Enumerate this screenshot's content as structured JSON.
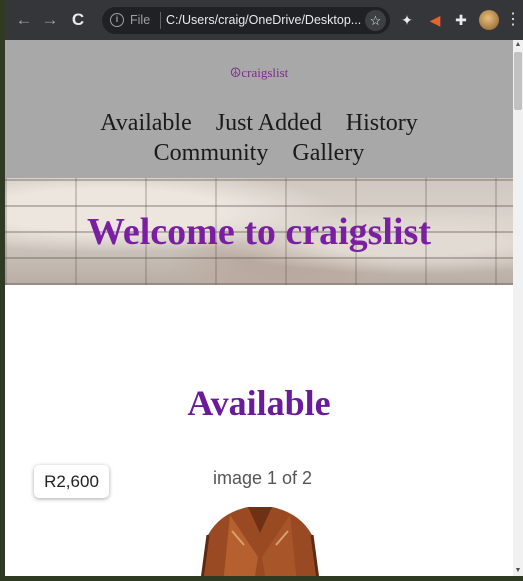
{
  "browser": {
    "url_prefix": "File",
    "url": "C:/Users/craig/OneDrive/Desktop...",
    "back_glyph": "←",
    "forward_glyph": "→",
    "reload_glyph": "C",
    "star_glyph": "☆",
    "menu_glyph": "⋮"
  },
  "site": {
    "logo": "☮craigslist",
    "nav_row1": [
      "Available",
      "Just Added",
      "History"
    ],
    "nav_row2": [
      "Community",
      "Gallery"
    ],
    "hero_title": "Welcome to craigslist"
  },
  "main": {
    "section_title": "Available",
    "price": "R2,600",
    "image_caption": "image 1 of 2"
  },
  "colors": {
    "accent_purple": "#7b1fa2",
    "header_gray": "#a8a8a8"
  }
}
